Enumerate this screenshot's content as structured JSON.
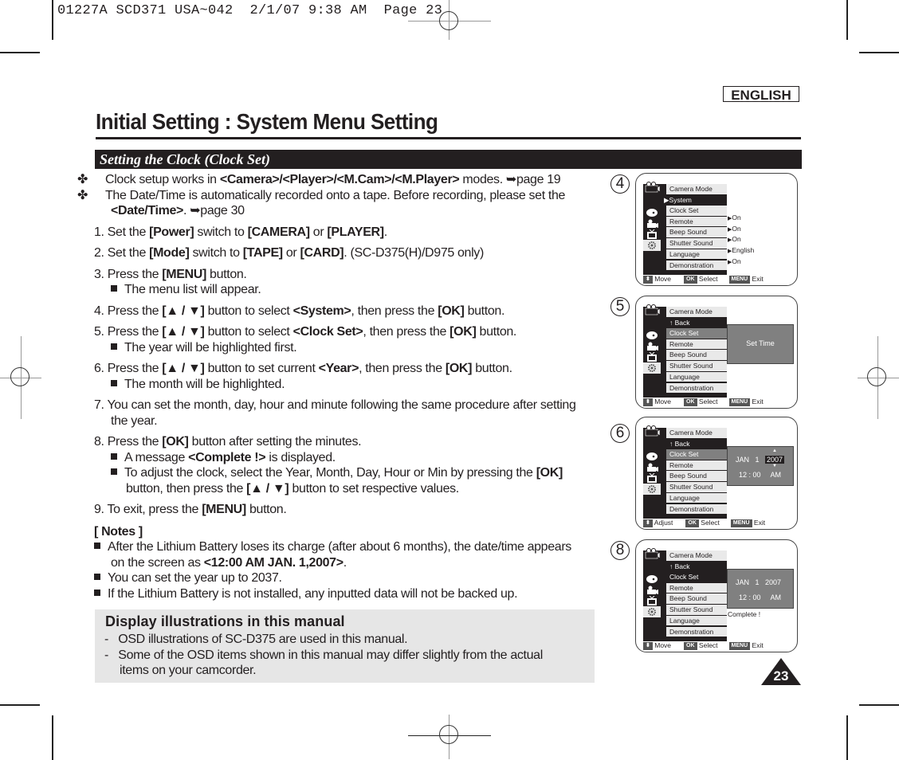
{
  "slug": "01227A SCD371 USA~042  2/1/07 9:38 AM  Page 23",
  "language_badge": "ENGLISH",
  "page_title": "Initial Setting : System Menu Setting",
  "section_title": "Setting the Clock (Clock Set)",
  "intro": [
    {
      "pre": "Clock setup works in ",
      "bold": "<Camera>/<Player>/<M.Cam>/<M.Player>",
      "post": " modes. ➥page 19"
    },
    {
      "pre": "The Date/Time is automatically recorded onto a tape. Before recording, please set the ",
      "bold": "<Date/Time>",
      "post": ". ➥page 30"
    }
  ],
  "steps": {
    "s1": {
      "a": "1. Set the ",
      "b1": "[Power]",
      "c": " switch to ",
      "b2": "[CAMERA]",
      "d": " or ",
      "b3": "[PLAYER]",
      "e": "."
    },
    "s2": {
      "a": "2. Set the ",
      "b1": "[Mode]",
      "c": " switch to ",
      "b2": "[TAPE]",
      "d": " or ",
      "b3": "[CARD]",
      "e": ". (SC-D375(H)/D975 only)"
    },
    "s3": {
      "a": "3. Press the ",
      "b1": "[MENU]",
      "c": " button.",
      "sub1": "The menu list will appear."
    },
    "s4": {
      "a": "4. Press the ",
      "b1": "[▲ / ▼]",
      "c": " button to select ",
      "b2": "<System>",
      "d": ", then press the ",
      "b3": "[OK]",
      "e": " button."
    },
    "s5": {
      "a": "5. Press the ",
      "b1": "[▲ / ▼]",
      "c": " button to select ",
      "b2": "<Clock Set>",
      "d": ", then press the ",
      "b3": "[OK]",
      "e": " button.",
      "sub1": "The year will be highlighted first."
    },
    "s6": {
      "a": "6. Press the ",
      "b1": "[▲ / ▼]",
      "c": " button to set current ",
      "b2": "<Year>",
      "d": ", then press the ",
      "b3": "[OK]",
      "e": " button.",
      "sub1": "The month will be highlighted."
    },
    "s7": {
      "a": "7. You can set the month, day, hour and minute following the same procedure after setting the year."
    },
    "s8": {
      "a": "8. Press the ",
      "b1": "[OK]",
      "c": " button after setting the minutes.",
      "sub1a": "A message ",
      "sub1b": "<Complete !>",
      "sub1c": " is displayed.",
      "sub2a": "To adjust the clock, select the Year, Month, Day, Hour or Min by pressing the ",
      "sub2b": "[OK]",
      "sub2c": " button, then press the ",
      "sub2d": "[▲ / ▼]",
      "sub2e": " button to set respective values."
    },
    "s9": {
      "a": "9. To exit, press the ",
      "b1": "[MENU]",
      "c": " button."
    }
  },
  "notes": {
    "heading": "[ Notes ]",
    "n1a": "After the Lithium Battery loses its charge (after about 6 months), the date/time appears on the screen as ",
    "n1b": "<12:00 AM JAN. 1,2007>",
    "n1c": ".",
    "n2": "You can set the year up to 2037.",
    "n3": "If the Lithium Battery is not installed, any inputted data will not be backed up."
  },
  "display_box": {
    "heading": "Display illustrations in this manual",
    "d1": "-   OSD illustrations of SC-D375 are used in this manual.",
    "d2": "-   Some of the OSD items shown in this manual may differ slightly from the actual",
    "d2b": "items on your camcorder."
  },
  "osd": {
    "camera_mode": "Camera Mode",
    "system": "▶System",
    "back": "↑ Back",
    "items": [
      "Clock Set",
      "Remote",
      "Beep Sound",
      "Shutter Sound",
      "Language",
      "Demonstration"
    ],
    "values": [
      "On",
      "On",
      "On",
      "English",
      "On"
    ],
    "set_time": "Set Time",
    "date": "JAN   1",
    "year": "2007",
    "time": "12 : 00",
    "ampm": "AM",
    "complete": "Complete !",
    "move": "Move",
    "adjust": "Adjust",
    "ok": "OK",
    "select": "Select",
    "menu": "MENU",
    "exit": "Exit",
    "step_numbers": [
      "4",
      "5",
      "6",
      "8"
    ]
  },
  "page_number": "23"
}
